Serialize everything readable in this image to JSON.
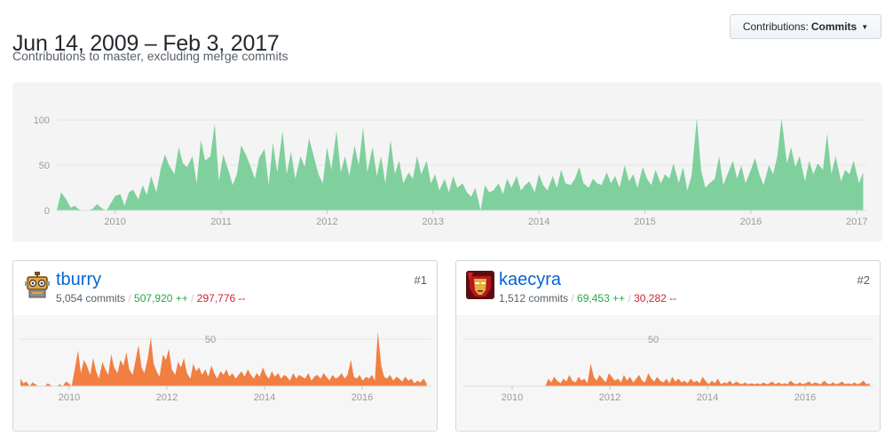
{
  "header": {
    "title": "Jun 14, 2009 – Feb 3, 2017",
    "subtitle": "Contributions to master, excluding merge commits"
  },
  "contributions_button": {
    "prefix": "Contributions:",
    "value": "Commits"
  },
  "colors": {
    "main_area": "#7fd09c",
    "user_area": "#f17f42",
    "link": "#0366d6",
    "additions": "#28a745",
    "deletions": "#cb2431"
  },
  "chart_data": [
    {
      "type": "area",
      "name": "main",
      "x_ticks": [
        "2010",
        "2011",
        "2012",
        "2013",
        "2014",
        "2015",
        "2016",
        "2017"
      ],
      "y_ticks": [
        "0",
        "50",
        "100"
      ],
      "ylim": [
        0,
        110
      ],
      "x_domain": [
        2009.45,
        2017.09
      ],
      "grid": true,
      "values": [
        0,
        20,
        12,
        3,
        5,
        1,
        0,
        0,
        2,
        7,
        2,
        0,
        8,
        16,
        18,
        5,
        20,
        23,
        12,
        28,
        17,
        38,
        20,
        46,
        62,
        50,
        40,
        70,
        52,
        48,
        60,
        30,
        78,
        55,
        60,
        96,
        32,
        62,
        44,
        28,
        40,
        72,
        60,
        48,
        35,
        58,
        68,
        28,
        75,
        42,
        88,
        40,
        65,
        35,
        60,
        48,
        80,
        62,
        40,
        30,
        70,
        45,
        88,
        42,
        60,
        38,
        72,
        50,
        92,
        42,
        70,
        38,
        60,
        30,
        78,
        40,
        55,
        30,
        42,
        35,
        60,
        40,
        55,
        30,
        40,
        22,
        35,
        20,
        38,
        25,
        30,
        20,
        15,
        25,
        0,
        28,
        20,
        22,
        30,
        18,
        35,
        25,
        38,
        22,
        28,
        32,
        20,
        40,
        28,
        22,
        38,
        25,
        45,
        30,
        28,
        35,
        48,
        30,
        25,
        35,
        30,
        28,
        42,
        30,
        38,
        25,
        50,
        32,
        40,
        25,
        48,
        35,
        28,
        45,
        30,
        40,
        35,
        52,
        30,
        48,
        22,
        38,
        102,
        45,
        25,
        30,
        35,
        60,
        28,
        40,
        55,
        35,
        50,
        30,
        45,
        58,
        40,
        28,
        50,
        40,
        60,
        102,
        52,
        70,
        48,
        60,
        32,
        55,
        40,
        52,
        45,
        85,
        40,
        60,
        32,
        45,
        40,
        55,
        30,
        42
      ],
      "period_start_years": [
        2009.45,
        2009.49,
        2009.54,
        2009.58,
        2009.62,
        2009.66,
        2009.71,
        2009.75,
        2009.79,
        2009.83,
        2009.88,
        2009.92,
        2009.96,
        2010.0,
        2010.05,
        2010.09,
        2010.13,
        2010.17,
        2010.22,
        2010.26,
        2010.3,
        2010.34,
        2010.39,
        2010.43,
        2010.47,
        2010.51,
        2010.56,
        2010.6,
        2010.64,
        2010.68,
        2010.73,
        2010.77,
        2010.81,
        2010.85,
        2010.9,
        2010.94,
        2010.98,
        2011.02,
        2011.07,
        2011.11,
        2011.15,
        2011.19,
        2011.24,
        2011.28,
        2011.32,
        2011.36,
        2011.41,
        2011.45,
        2011.49,
        2011.53,
        2011.58,
        2011.62,
        2011.66,
        2011.7,
        2011.75,
        2011.79,
        2011.83,
        2011.87,
        2011.92,
        2011.96,
        2012.0,
        2012.04,
        2012.09,
        2012.13,
        2012.17,
        2012.21,
        2012.26,
        2012.3,
        2012.34,
        2012.38,
        2012.43,
        2012.47,
        2012.51,
        2012.55,
        2012.6,
        2012.64,
        2012.68,
        2012.72,
        2012.77,
        2012.81,
        2012.85,
        2012.89,
        2012.94,
        2012.98,
        2013.02,
        2013.06,
        2013.11,
        2013.15,
        2013.19,
        2013.23,
        2013.28,
        2013.32,
        2013.36,
        2013.4,
        2013.45,
        2013.49,
        2013.53,
        2013.57,
        2013.62,
        2013.66,
        2013.7,
        2013.74,
        2013.79,
        2013.83,
        2013.87,
        2013.91,
        2013.96,
        2014.0,
        2014.04,
        2014.08,
        2014.13,
        2014.17,
        2014.21,
        2014.25,
        2014.3,
        2014.34,
        2014.38,
        2014.42,
        2014.47,
        2014.51,
        2014.55,
        2014.59,
        2014.64,
        2014.68,
        2014.72,
        2014.76,
        2014.81,
        2014.85,
        2014.89,
        2014.93,
        2014.98,
        2015.02,
        2015.06,
        2015.1,
        2015.15,
        2015.19,
        2015.23,
        2015.27,
        2015.32,
        2015.36,
        2015.4,
        2015.44,
        2015.49,
        2015.53,
        2015.57,
        2015.61,
        2015.66,
        2015.7,
        2015.74,
        2015.78,
        2015.83,
        2015.87,
        2015.91,
        2015.95,
        2016.0,
        2016.04,
        2016.08,
        2016.12,
        2016.17,
        2016.21,
        2016.25,
        2016.29,
        2016.34,
        2016.38,
        2016.42,
        2016.46,
        2016.51,
        2016.55,
        2016.59,
        2016.63,
        2016.68,
        2016.72,
        2016.76,
        2016.8,
        2016.85,
        2016.89,
        2016.93,
        2016.97,
        2017.02,
        2017.06
      ]
    },
    {
      "type": "area",
      "name": "tburry",
      "x_ticks": [
        "2010",
        "2012",
        "2014",
        "2016"
      ],
      "y_ticks": [
        "50"
      ],
      "ylim": [
        0,
        70
      ],
      "x_domain": [
        2009.0,
        2017.4
      ],
      "grid": true,
      "values": [
        8,
        3,
        5,
        0,
        4,
        2,
        0,
        0,
        0,
        3,
        1,
        0,
        0,
        2,
        0,
        5,
        3,
        0,
        20,
        38,
        14,
        28,
        22,
        12,
        30,
        16,
        8,
        26,
        18,
        12,
        34,
        20,
        14,
        28,
        22,
        36,
        18,
        12,
        28,
        44,
        20,
        14,
        30,
        52,
        24,
        16,
        10,
        34,
        28,
        40,
        18,
        12,
        26,
        20,
        30,
        14,
        8,
        24,
        16,
        20,
        12,
        18,
        10,
        22,
        14,
        8,
        16,
        12,
        18,
        10,
        14,
        8,
        12,
        16,
        10,
        18,
        12,
        8,
        14,
        10,
        20,
        12,
        8,
        16,
        10,
        14,
        8,
        12,
        10,
        6,
        14,
        8,
        12,
        10,
        8,
        14,
        6,
        10,
        12,
        8,
        14,
        10,
        6,
        12,
        8,
        10,
        14,
        8,
        12,
        28,
        10,
        8,
        12,
        6,
        10,
        8,
        12,
        6,
        58,
        22,
        10,
        8,
        12,
        6,
        10,
        8,
        5,
        10,
        6,
        8,
        3,
        6,
        4,
        8,
        3
      ],
      "period_start_years": [
        2009.0,
        2009.06,
        2009.12,
        2009.19,
        2009.25,
        2009.31,
        2009.37,
        2009.43,
        2009.5,
        2009.56,
        2009.62,
        2009.68,
        2009.74,
        2009.81,
        2009.87,
        2009.93,
        2009.99,
        2010.05,
        2010.12,
        2010.18,
        2010.24,
        2010.3,
        2010.36,
        2010.43,
        2010.49,
        2010.55,
        2010.61,
        2010.68,
        2010.74,
        2010.8,
        2010.86,
        2010.92,
        2010.99,
        2011.05,
        2011.11,
        2011.17,
        2011.23,
        2011.3,
        2011.36,
        2011.42,
        2011.48,
        2011.54,
        2011.61,
        2011.67,
        2011.73,
        2011.79,
        2011.85,
        2011.92,
        2011.98,
        2012.04,
        2012.1,
        2012.17,
        2012.23,
        2012.29,
        2012.35,
        2012.41,
        2012.48,
        2012.54,
        2012.6,
        2012.66,
        2012.72,
        2012.79,
        2012.85,
        2012.91,
        2012.97,
        2013.03,
        2013.1,
        2013.16,
        2013.22,
        2013.28,
        2013.34,
        2013.41,
        2013.47,
        2013.53,
        2013.59,
        2013.66,
        2013.72,
        2013.78,
        2013.84,
        2013.9,
        2013.97,
        2014.03,
        2014.09,
        2014.15,
        2014.21,
        2014.28,
        2014.34,
        2014.4,
        2014.46,
        2014.52,
        2014.59,
        2014.65,
        2014.71,
        2014.77,
        2014.83,
        2014.9,
        2014.96,
        2015.02,
        2015.08,
        2015.15,
        2015.21,
        2015.27,
        2015.33,
        2015.39,
        2015.46,
        2015.52,
        2015.58,
        2015.64,
        2015.7,
        2015.77,
        2015.83,
        2015.89,
        2015.95,
        2016.01,
        2016.08,
        2016.14,
        2016.2,
        2016.26,
        2016.32,
        2016.39,
        2016.45,
        2016.51,
        2016.57,
        2016.64,
        2016.7,
        2016.76,
        2016.82,
        2016.88,
        2016.95,
        2017.01,
        2017.07,
        2017.13,
        2017.19,
        2017.26,
        2017.32
      ]
    },
    {
      "type": "area",
      "name": "kaecyra",
      "x_ticks": [
        "2010",
        "2012",
        "2014",
        "2016"
      ],
      "y_ticks": [
        "50"
      ],
      "ylim": [
        0,
        70
      ],
      "x_domain": [
        2009.0,
        2017.4
      ],
      "grid": true,
      "values": [
        0,
        0,
        0,
        0,
        0,
        0,
        0,
        0,
        0,
        0,
        0,
        0,
        0,
        0,
        0,
        0,
        0,
        0,
        0,
        0,
        0,
        0,
        0,
        0,
        0,
        0,
        0,
        0,
        8,
        4,
        10,
        6,
        3,
        8,
        5,
        12,
        6,
        4,
        10,
        6,
        8,
        3,
        24,
        10,
        6,
        12,
        8,
        4,
        14,
        10,
        6,
        8,
        4,
        12,
        6,
        10,
        4,
        8,
        12,
        6,
        4,
        14,
        8,
        5,
        10,
        6,
        4,
        8,
        3,
        10,
        5,
        8,
        4,
        6,
        3,
        8,
        4,
        6,
        3,
        10,
        5,
        2,
        6,
        3,
        8,
        2,
        4,
        3,
        6,
        2,
        5,
        3,
        2,
        4,
        2,
        3,
        2,
        3,
        2,
        4,
        2,
        3,
        5,
        2,
        4,
        2,
        3,
        2,
        6,
        3,
        2,
        4,
        2,
        3,
        5,
        2,
        4,
        3,
        2,
        6,
        3,
        2,
        4,
        2,
        3,
        5,
        2,
        3,
        2,
        4,
        2,
        3,
        6,
        2,
        3
      ],
      "period_start_years": [
        2009.0,
        2009.06,
        2009.12,
        2009.19,
        2009.25,
        2009.31,
        2009.37,
        2009.43,
        2009.5,
        2009.56,
        2009.62,
        2009.68,
        2009.74,
        2009.81,
        2009.87,
        2009.93,
        2009.99,
        2010.05,
        2010.12,
        2010.18,
        2010.24,
        2010.3,
        2010.36,
        2010.43,
        2010.49,
        2010.55,
        2010.61,
        2010.68,
        2010.74,
        2010.8,
        2010.86,
        2010.92,
        2010.99,
        2011.05,
        2011.11,
        2011.17,
        2011.23,
        2011.3,
        2011.36,
        2011.42,
        2011.48,
        2011.54,
        2011.61,
        2011.67,
        2011.73,
        2011.79,
        2011.85,
        2011.92,
        2011.98,
        2012.04,
        2012.1,
        2012.17,
        2012.23,
        2012.29,
        2012.35,
        2012.41,
        2012.48,
        2012.54,
        2012.6,
        2012.66,
        2012.72,
        2012.79,
        2012.85,
        2012.91,
        2012.97,
        2013.03,
        2013.1,
        2013.16,
        2013.22,
        2013.28,
        2013.34,
        2013.41,
        2013.47,
        2013.53,
        2013.59,
        2013.66,
        2013.72,
        2013.78,
        2013.84,
        2013.9,
        2013.97,
        2014.03,
        2014.09,
        2014.15,
        2014.21,
        2014.28,
        2014.34,
        2014.4,
        2014.46,
        2014.52,
        2014.59,
        2014.65,
        2014.71,
        2014.77,
        2014.83,
        2014.9,
        2014.96,
        2015.02,
        2015.08,
        2015.15,
        2015.21,
        2015.27,
        2015.33,
        2015.39,
        2015.46,
        2015.52,
        2015.58,
        2015.64,
        2015.7,
        2015.77,
        2015.83,
        2015.89,
        2015.95,
        2016.01,
        2016.08,
        2016.14,
        2016.2,
        2016.26,
        2016.32,
        2016.39,
        2016.45,
        2016.51,
        2016.57,
        2016.64,
        2016.7,
        2016.76,
        2016.82,
        2016.88,
        2016.95,
        2017.01,
        2017.07,
        2017.13,
        2017.19,
        2017.26,
        2017.32
      ]
    }
  ],
  "contributors": [
    {
      "rank": "#1",
      "username": "tburry",
      "commits": "5,054 commits",
      "additions": "507,920 ++",
      "deletions": "297,776 --",
      "avatar_icon": "robot-avatar-icon"
    },
    {
      "rank": "#2",
      "username": "kaecyra",
      "commits": "1,512 commits",
      "additions": "69,453 ++",
      "deletions": "30,282 --",
      "avatar_icon": "ironman-avatar-icon"
    }
  ]
}
